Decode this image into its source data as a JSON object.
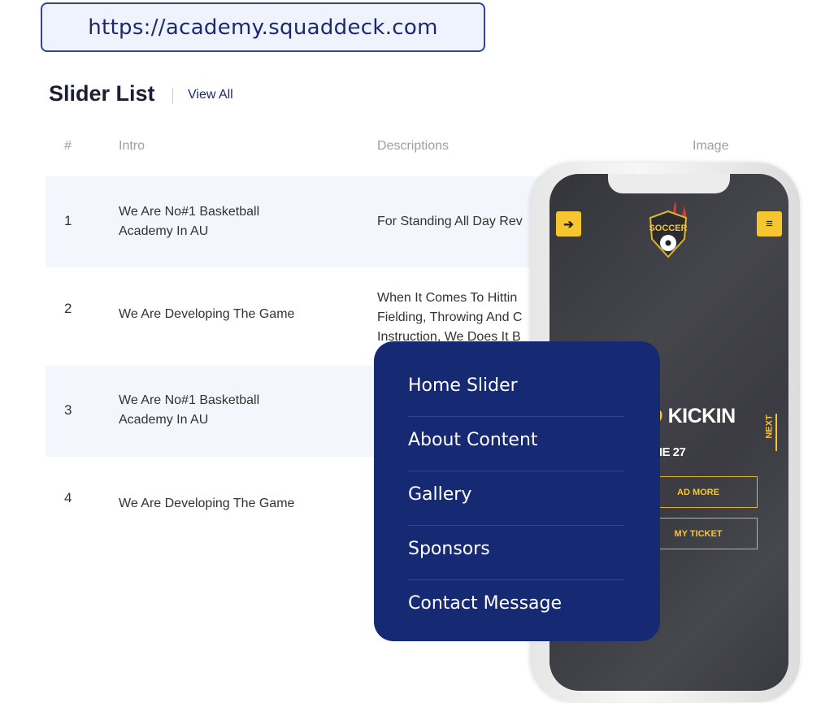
{
  "url": "https://academy.squaddeck.com",
  "title": "Slider List",
  "view_all": "View All",
  "columns": [
    "#",
    "Intro",
    "Descriptions",
    "Image"
  ],
  "rows": [
    {
      "num": "1",
      "intro": "We Are No#1 Basketball Academy In AU",
      "desc": [
        "For Standing All Day Rev"
      ]
    },
    {
      "num": "2",
      "intro": "We Are Developing The Game",
      "desc": [
        "When It Comes To Hittin",
        "Fielding, Throwing And C",
        "Instruction, We Does It B"
      ]
    },
    {
      "num": "3",
      "intro": "We Are No#1 Basketball Academy In AU",
      "desc": []
    },
    {
      "num": "4",
      "intro": "We Are Developing The Game",
      "desc": []
    }
  ],
  "menu": [
    "Home Slider",
    "About Content",
    "Gallery",
    "Sponsors",
    "Contact Message"
  ],
  "phone": {
    "logo_text": "PRO SOCCER",
    "headline_yellow": "ND",
    "headline_white": "KICKIN",
    "date": "JUNE 27",
    "next": "NEXT",
    "btn1": "AD MORE",
    "btn2": "MY TICKET",
    "accent": "#f6c631"
  },
  "colors": {
    "menu_bg": "#152a73",
    "row_alt": "#f3f6fd"
  }
}
